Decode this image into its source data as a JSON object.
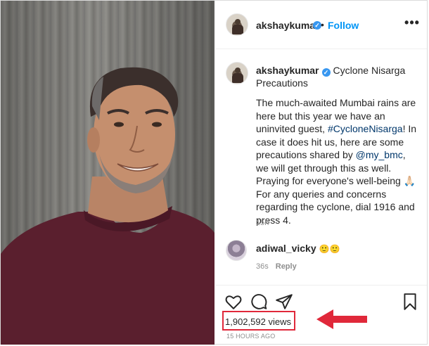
{
  "header": {
    "username": "akshaykumar",
    "separator": "•",
    "follow_label": "Follow",
    "more_label": "•••"
  },
  "caption": {
    "username": "akshaykumar",
    "title": "Cyclone Nisarga Precautions",
    "text_1": "The much-awaited Mumbai rains are here but this year we have an uninvited guest, ",
    "hashtag": "#CycloneNisarga",
    "text_2": "! In case it does hit us, here are some precautions shared by ",
    "mention": "@my_bmc",
    "text_3": ", we will get through this as well. Praying for everyone's well-being 🙏🏻",
    "text_4": "For any queries and concerns regarding the cyclone, dial 1916 and press 4.",
    "age": "15h"
  },
  "comment": {
    "username": "adiwal_vicky",
    "text": "🙂🙂",
    "age": "36s",
    "reply_label": "Reply"
  },
  "footer": {
    "views": "1,902,592 views",
    "posted": "15 HOURS AGO"
  },
  "colors": {
    "link_blue": "#0095f6",
    "verified_blue": "#3897f0",
    "highlight_red": "#e0283a"
  },
  "icons": [
    "heart-icon",
    "comment-icon",
    "share-icon",
    "bookmark-icon",
    "verified-icon",
    "more-icon",
    "red-arrow-icon"
  ]
}
